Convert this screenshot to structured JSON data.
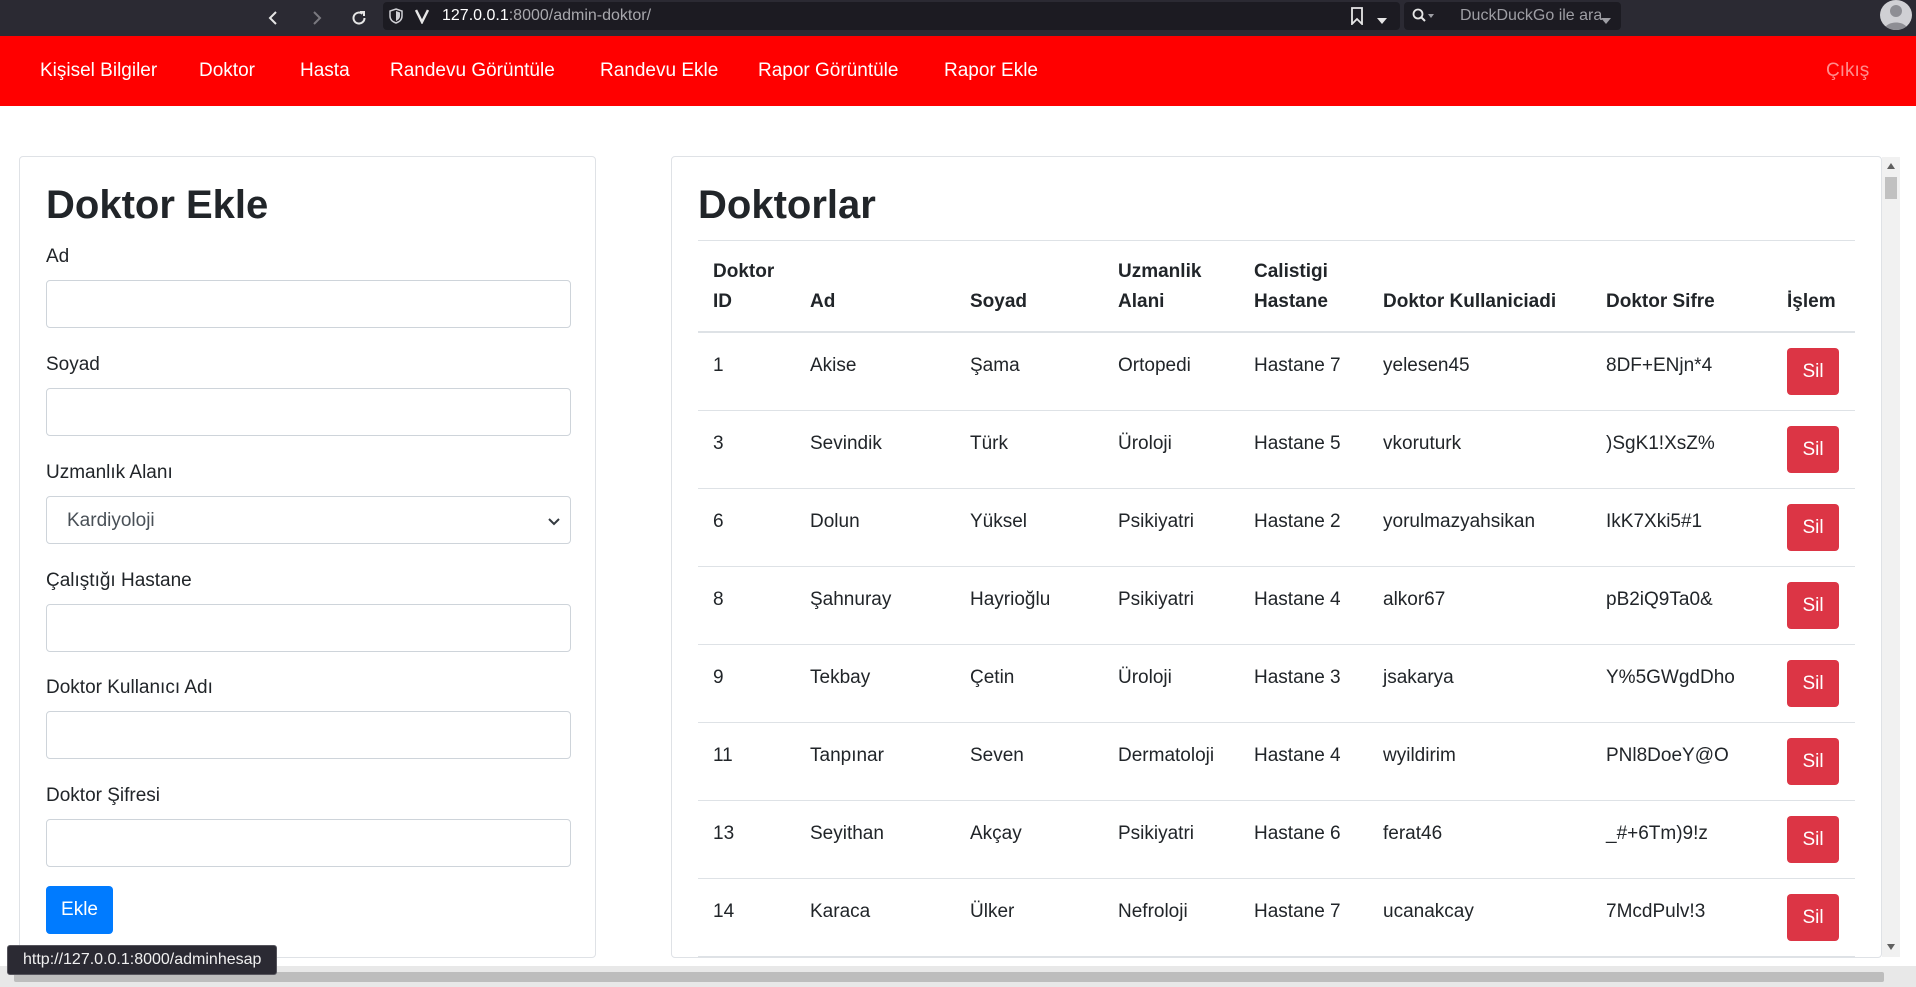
{
  "browser": {
    "url_host": "127.0.0.1",
    "url_path": ":8000/admin-doktor/",
    "search_placeholder": "DuckDuckGo ile ara",
    "status_url": "http://127.0.0.1:8000/adminhesap"
  },
  "navbar": {
    "items": [
      "Kişisel Bilgiler",
      "Doktor",
      "Hasta",
      "Randevu Görüntüle",
      "Randevu Ekle",
      "Rapor Görüntüle",
      "Rapor Ekle"
    ],
    "logout": "Çıkış"
  },
  "form": {
    "title": "Doktor Ekle",
    "first_name_label": "Ad",
    "last_name_label": "Soyad",
    "specialty_label": "Uzmanlık Alanı",
    "specialty_value": "Kardiyoloji",
    "hospital_label": "Çalıştığı Hastane",
    "username_label": "Doktor Kullanıcı Adı",
    "password_label": "Doktor Şifresi",
    "submit": "Ekle"
  },
  "table": {
    "title": "Doktorlar",
    "headers": {
      "id_1": "Doktor",
      "id_2": "ID",
      "ad": "Ad",
      "soyad": "Soyad",
      "uzm_1": "Uzmanlik",
      "uzm_2": "Alani",
      "hast_1": "Calistigi",
      "hast_2": "Hastane",
      "kullanici": "Doktor Kullaniciadi",
      "sifre": "Doktor Sifre",
      "islem": "İşlem"
    },
    "delete_label": "Sil",
    "rows": [
      {
        "id": "1",
        "ad": "Akise",
        "soyad": "Şama",
        "uzmanlik": "Ortopedi",
        "hastane": "Hastane 7",
        "kullanici": "yelesen45",
        "sifre": "8DF+ENjn*4"
      },
      {
        "id": "3",
        "ad": "Sevindik",
        "soyad": "Türk",
        "uzmanlik": "Üroloji",
        "hastane": "Hastane 5",
        "kullanici": "vkoruturk",
        "sifre": ")SgK1!XsZ%"
      },
      {
        "id": "6",
        "ad": "Dolun",
        "soyad": "Yüksel",
        "uzmanlik": "Psikiyatri",
        "hastane": "Hastane 2",
        "kullanici": "yorulmazyahsikan",
        "sifre": "IkK7Xki5#1"
      },
      {
        "id": "8",
        "ad": "Şahnuray",
        "soyad": "Hayrioğlu",
        "uzmanlik": "Psikiyatri",
        "hastane": "Hastane 4",
        "kullanici": "alkor67",
        "sifre": "pB2iQ9Ta0&"
      },
      {
        "id": "9",
        "ad": "Tekbay",
        "soyad": "Çetin",
        "uzmanlik": "Üroloji",
        "hastane": "Hastane 3",
        "kullanici": "jsakarya",
        "sifre": "Y%5GWgdDho"
      },
      {
        "id": "11",
        "ad": "Tanpınar",
        "soyad": "Seven",
        "uzmanlik": "Dermatoloji",
        "hastane": "Hastane 4",
        "kullanici": "wyildirim",
        "sifre": "PNl8DoeY@O"
      },
      {
        "id": "13",
        "ad": "Seyithan",
        "soyad": "Akçay",
        "uzmanlik": "Psikiyatri",
        "hastane": "Hastane 6",
        "kullanici": "ferat46",
        "sifre": "_#+6Tm)9!z"
      },
      {
        "id": "14",
        "ad": "Karaca",
        "soyad": "Ülker",
        "uzmanlik": "Nefroloji",
        "hastane": "Hastane 7",
        "kullanici": "ucanakcay",
        "sifre": "7McdPulv!3"
      }
    ]
  },
  "icons": [
    "back-icon",
    "forward-icon",
    "reload-icon",
    "shield-icon",
    "site-icon",
    "bookmark-icon",
    "dropdown-icon",
    "search-icon",
    "avatar-icon",
    "chevron-down-icon"
  ],
  "colors": {
    "navbar": "#ff0000",
    "primary": "#007bff",
    "danger": "#dc3545"
  }
}
